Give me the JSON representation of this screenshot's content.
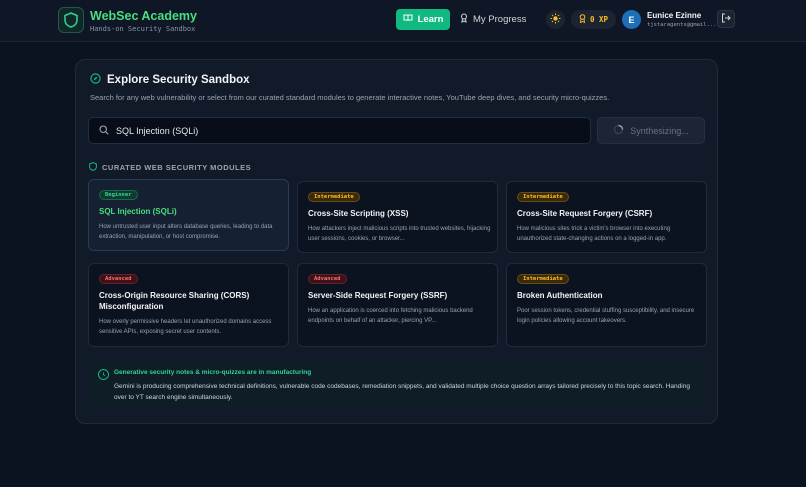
{
  "header": {
    "brand_title": "WebSec Academy",
    "brand_subtitle": "Hands-on Security Sandbox",
    "nav_learn": "Learn",
    "nav_progress": "My Progress",
    "xp": "0 XP",
    "user_initial": "E",
    "user_name": "Eunice Ezinne",
    "user_email": "tjstaragents@gmail..."
  },
  "panel": {
    "title": "Explore Security Sandbox",
    "description": "Search for any web vulnerability or select from our curated standard modules to generate interactive notes, YouTube deep dives, and security micro-quizzes.",
    "search_value": "SQL Injection (SQLi)",
    "synth_label": "Synthesizing...",
    "section_label": "CURATED WEB SECURITY MODULES"
  },
  "modules": [
    {
      "level": "Beginner",
      "title": "SQL Injection (SQLi)",
      "desc": "How untrusted user input alters database queries, leading to data extraction, manipulation, or host compromise."
    },
    {
      "level": "Intermediate",
      "title": "Cross-Site Scripting (XSS)",
      "desc": "How attackers inject malicious scripts into trusted websites, hijacking user sessions, cookies, or browser..."
    },
    {
      "level": "Intermediate",
      "title": "Cross-Site Request Forgery (CSRF)",
      "desc": "How malicious sites trick a victim's browser into executing unauthorized state-changing actions on a logged-in app."
    },
    {
      "level": "Advanced",
      "title": "Cross-Origin Resource Sharing (CORS) Misconfiguration",
      "desc": "How overly permissive headers let unauthorized domains access sensitive APIs, exposing secret user contents."
    },
    {
      "level": "Advanced",
      "title": "Server-Side Request Forgery (SSRF)",
      "desc": "How an application is coerced into fetching malicious backend endpoints on behalf of an attacker, piercing VP..."
    },
    {
      "level": "Intermediate",
      "title": "Broken Authentication",
      "desc": "Poor session tokens, credential stuffing susceptibility, and insecure login policies allowing account takeovers."
    }
  ],
  "info": {
    "title": "Generative security notes & micro-quizzes are in manufacturing",
    "body": "Gemini is producing comprehensive technical definitions, vulnerable code codebases, remediation snippets, and validated multiple choice question arrays tailored precisely to this topic search. Handing over to YT search engine simultaneously."
  },
  "colors": {
    "accent": "#10b981",
    "brand": "#4ade80",
    "background": "#0b1220"
  }
}
